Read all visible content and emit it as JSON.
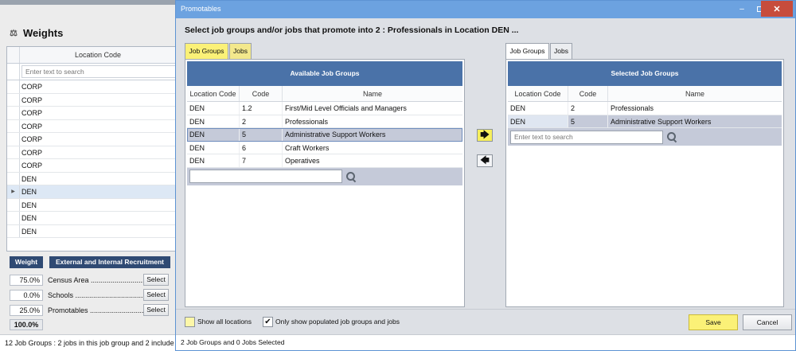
{
  "background_window": {
    "title": "Weights",
    "icon": "scale-icon",
    "column_header": "Location Code",
    "search_placeholder": "Enter text to search",
    "rows": [
      "CORP",
      "CORP",
      "CORP",
      "CORP",
      "CORP",
      "CORP",
      "CORP",
      "DEN",
      "DEN",
      "DEN",
      "DEN",
      "DEN"
    ],
    "selected_row_index": 8,
    "weight_header": "Weight",
    "recruitment_header": "External and Internal Recruitment",
    "weights": [
      {
        "pct": "75.0%",
        "label": "Census Area ............................",
        "button": "Select"
      },
      {
        "pct": "0.0%",
        "label": "Schools ......................................",
        "button": "Select"
      },
      {
        "pct": "25.0%",
        "label": "Promotables ............................",
        "button": "Select"
      }
    ],
    "total": "100.0%",
    "status": "12 Job Groups : 2 jobs in this job group and 2 include"
  },
  "dialog": {
    "title": "Promotables",
    "heading": "Select job groups and/or jobs that promote into 2 : Professionals in Location DEN ...",
    "window_controls": {
      "minimize": "–",
      "close": "✕"
    },
    "left_tabs": [
      "Job Groups",
      "Jobs"
    ],
    "right_tabs": [
      "Job Groups",
      "Jobs"
    ],
    "available": {
      "header": "Available Job Groups",
      "columns": [
        "Location Code",
        "Code",
        "Name"
      ],
      "rows": [
        [
          "DEN",
          "1.2",
          "First/Mid Level Officials and Managers"
        ],
        [
          "DEN",
          "2",
          "Professionals"
        ],
        [
          "DEN",
          "5",
          "Administrative Support Workers"
        ],
        [
          "DEN",
          "6",
          "Craft Workers"
        ],
        [
          "DEN",
          "7",
          "Operatives"
        ]
      ],
      "selected_row_index": 2,
      "search_value": ""
    },
    "selected": {
      "header": "Selected Job Groups",
      "columns": [
        "Location Code",
        "Code",
        "Name"
      ],
      "rows": [
        [
          "DEN",
          "2",
          "Professionals"
        ],
        [
          "DEN",
          "5",
          "Administrative Support Workers"
        ]
      ],
      "selected_row_index": 1,
      "search_placeholder": "Enter text to search"
    },
    "move_right_glyph": "🡆",
    "move_left_glyph": "🡄",
    "show_all_label": "Show all locations",
    "show_all_checked": false,
    "populated_label": "Only show populated job groups and jobs",
    "populated_checked": true,
    "save_label": "Save",
    "cancel_label": "Cancel",
    "status": "2 Job Groups and 0 Jobs Selected"
  },
  "colors": {
    "accent_yellow": "#FBF177",
    "panel_header": "#4A72A8",
    "titlebar": "#6CA2E0",
    "close_red": "#C74C3C",
    "selected_row": "#C5CAD9"
  }
}
